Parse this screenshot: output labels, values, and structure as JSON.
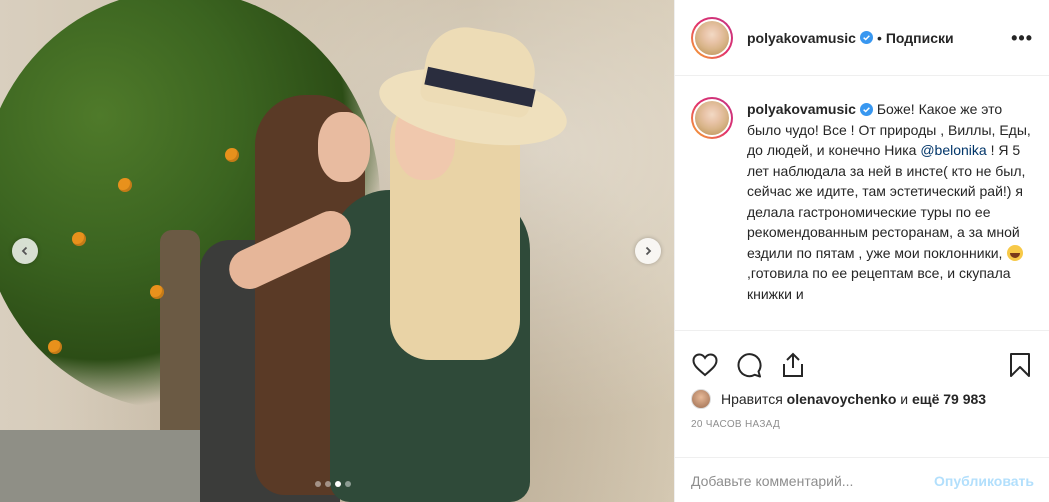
{
  "post": {
    "username": "polyakovamusic",
    "follow_separator": "•",
    "follow_label": "Подписки",
    "more_glyph": "•••"
  },
  "caption": {
    "username": "polyakovamusic",
    "text_part1": "Боже! Какое же это было чудо! Все ! От природы , Виллы, Еды, до людей, и конечно Ника ",
    "mention": "@belonika",
    "text_part2": " ! Я 5 лет наблюдала за ней в инсте( кто не был, сейчас же идите, там эстетический рай!) я делала гастрономические туры по ее рекомендованным ресторанам, а за мной ездили по пятам , уже мои поклонники, ",
    "text_part3": ",готовила по ее рецептам все, и скупала книжки и"
  },
  "likes": {
    "prefix": "Нравится",
    "liker": "olenavoychenko",
    "connector": "и",
    "count_text": "ещё 79 983"
  },
  "timestamp": "20 часов назад",
  "comment": {
    "placeholder": "Добавьте комментарий...",
    "post_label": "Опубликовать"
  },
  "carousel": {
    "slide_count": 4,
    "active_index": 2
  },
  "colors": {
    "verified_blue": "#3897f0",
    "link_blue": "#003569",
    "post_disabled": "#b2dffc"
  }
}
